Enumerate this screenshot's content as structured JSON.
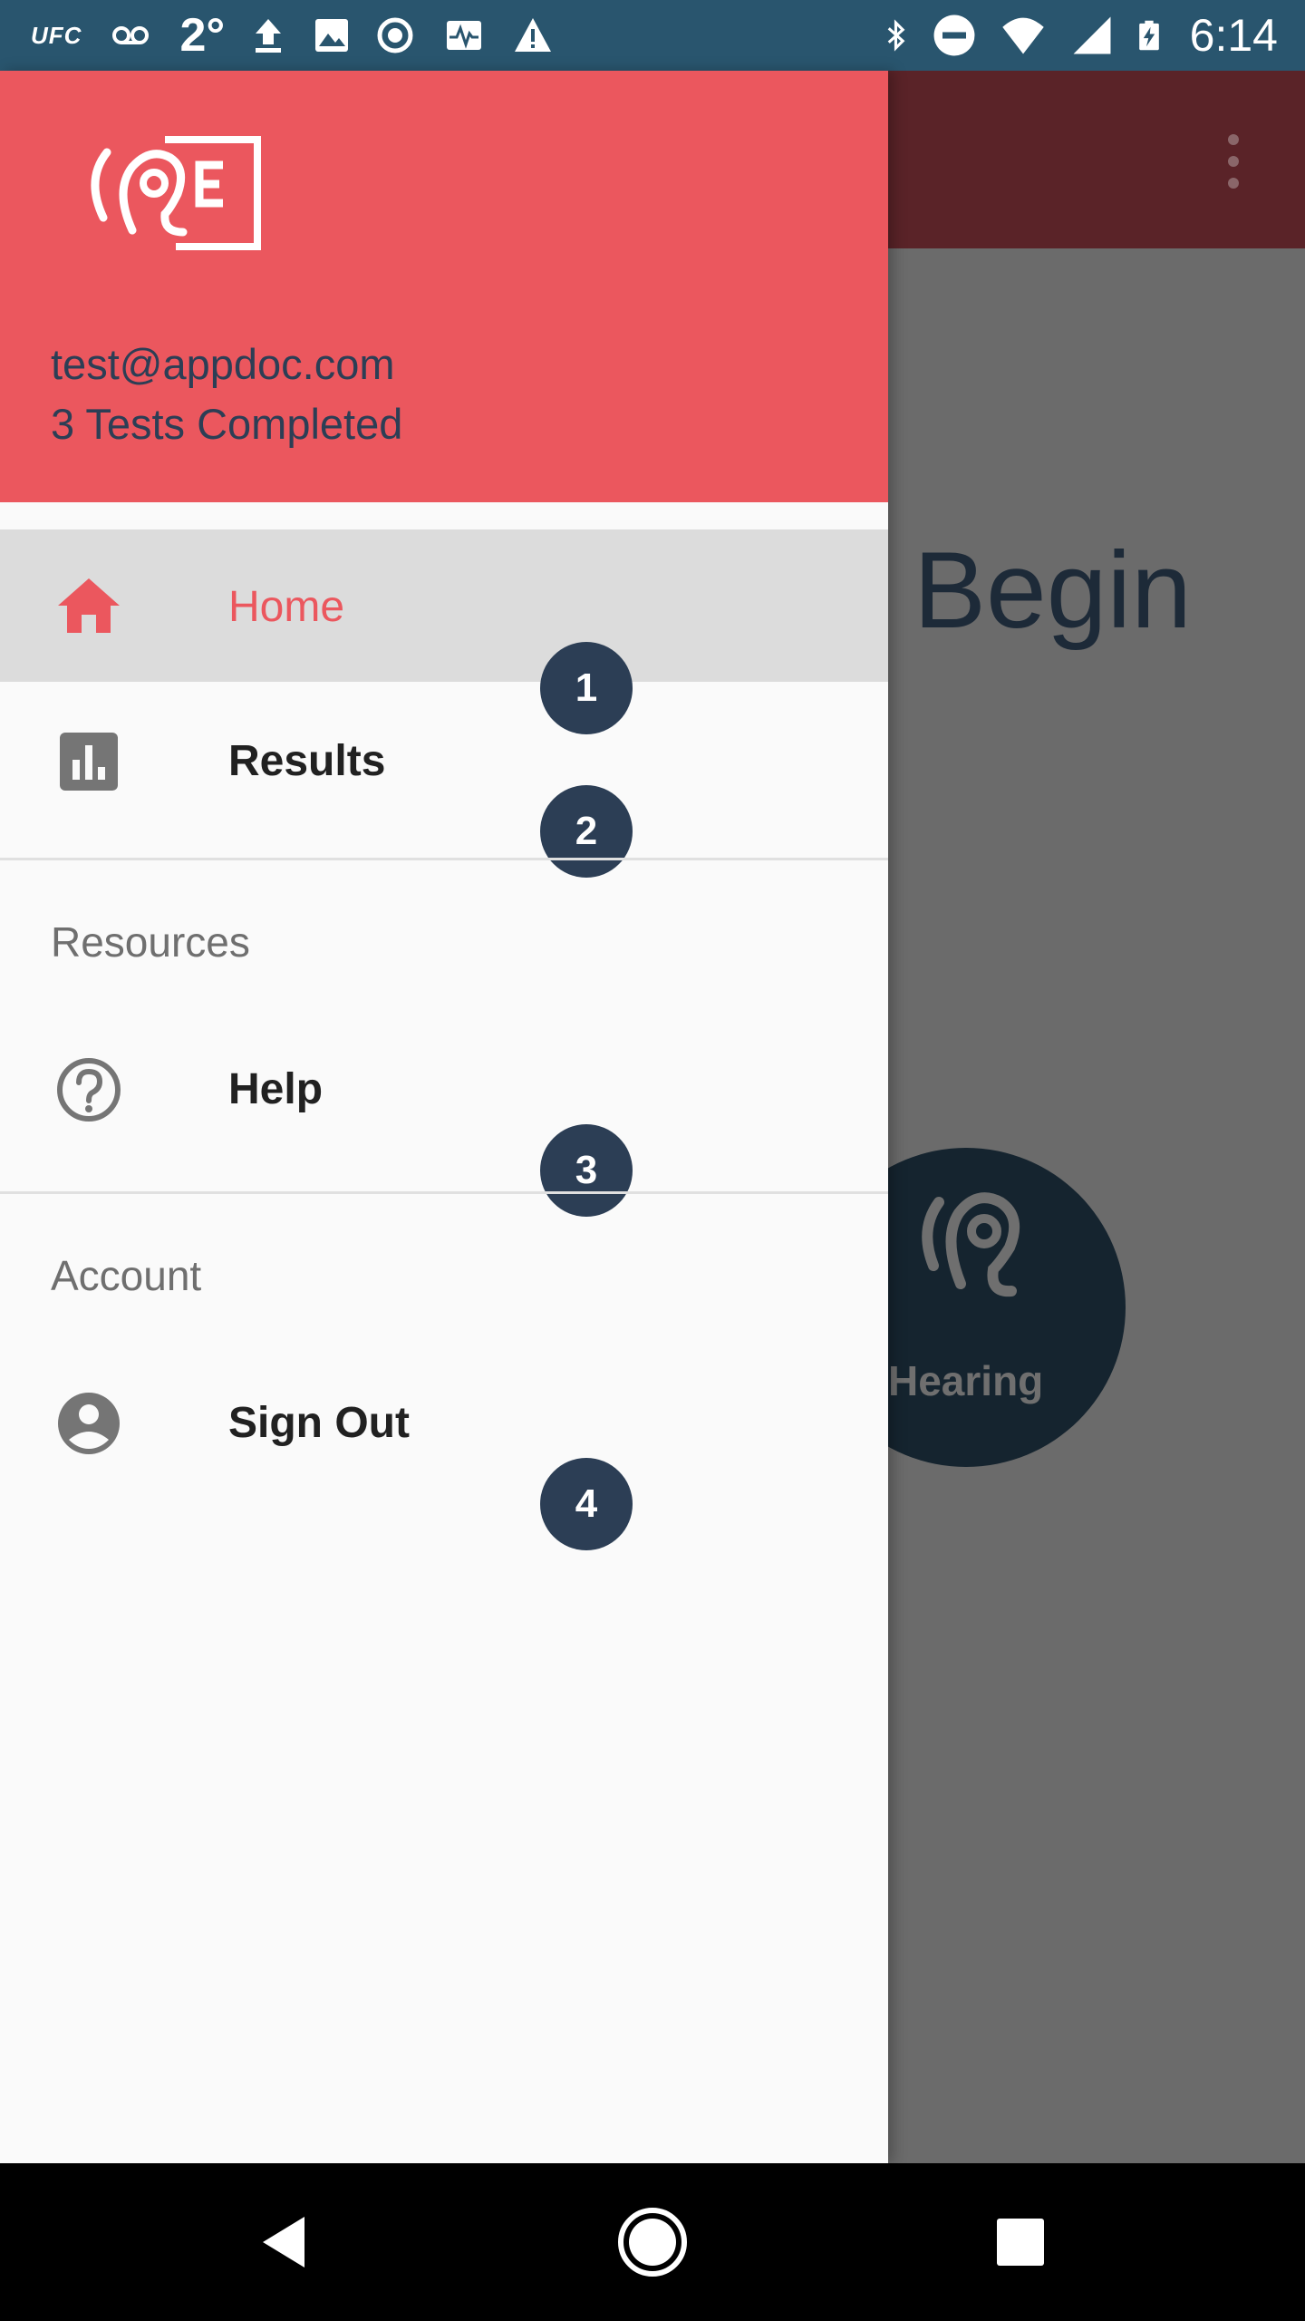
{
  "status_bar": {
    "carrier_text": "UFC",
    "temperature": "2°",
    "time": "6:14"
  },
  "background_app": {
    "begin_text": "Begin",
    "hearing_label": "Hearing"
  },
  "drawer": {
    "header": {
      "email": "test@appdoc.com",
      "tests_completed": "3 Tests Completed"
    },
    "items": [
      {
        "label": "Home",
        "icon": "home-icon",
        "badge": "1",
        "selected": true
      },
      {
        "label": "Results",
        "icon": "bar-chart-icon",
        "badge": "2",
        "selected": false
      }
    ],
    "sections": [
      {
        "title": "Resources",
        "items": [
          {
            "label": "Help",
            "icon": "help-circle-icon",
            "badge": "3"
          }
        ]
      },
      {
        "title": "Account",
        "items": [
          {
            "label": "Sign Out",
            "icon": "account-circle-icon",
            "badge": "4"
          }
        ]
      }
    ]
  },
  "colors": {
    "status_bar": "#29556e",
    "header": "#eb575e",
    "accent": "#eb575e",
    "badge": "#2c3e55",
    "selected_bg": "#dcdcdc"
  }
}
